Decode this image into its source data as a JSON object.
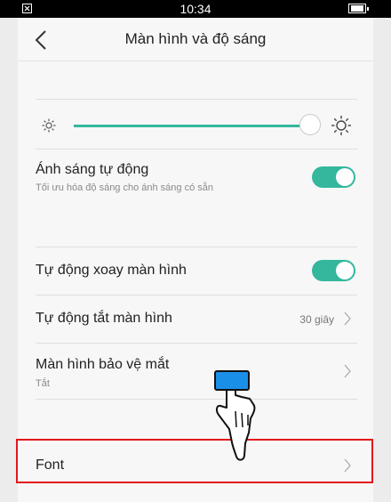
{
  "status_bar": {
    "time": "10:34"
  },
  "header": {
    "title": "Màn hình và độ sáng",
    "back_icon": "chevron-left-icon"
  },
  "brightness": {
    "level": 0.98,
    "accent": "#34b79c"
  },
  "auto_brightness": {
    "label": "Ánh sáng tự động",
    "subtitle": "Tối ưu hóa độ sáng cho ánh sáng có sẵn",
    "enabled": true
  },
  "auto_rotate": {
    "label": "Tự động xoay màn hình",
    "enabled": true
  },
  "screen_timeout": {
    "label": "Tự động tắt màn hình",
    "value": "30 giây"
  },
  "eye_protection": {
    "label": "Màn hình bảo vệ mắt",
    "value": "Tắt"
  },
  "font": {
    "label": "Font"
  },
  "colors": {
    "accent": "#34b79c",
    "highlight": "#e3171c"
  }
}
